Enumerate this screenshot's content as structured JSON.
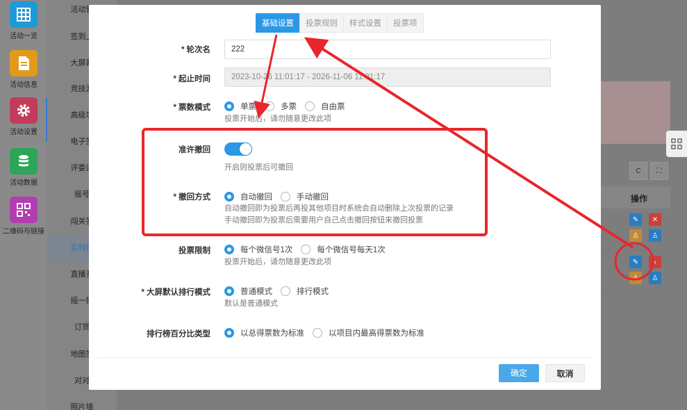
{
  "rail": {
    "items": [
      {
        "label": "活动一览",
        "icon": "grid-icon",
        "color": "#1e9ad6"
      },
      {
        "label": "活动信息",
        "icon": "document-icon",
        "color": "#e39a1b"
      },
      {
        "label": "活动设置",
        "icon": "gear-icon",
        "color": "#c23b5a"
      },
      {
        "label": "活动数据",
        "icon": "database-icon",
        "color": "#2ca556"
      },
      {
        "label": "二维码与链接",
        "icon": "qrcode-icon",
        "color": "#b23db0"
      }
    ]
  },
  "submenu": {
    "items": [
      "活动管",
      "签到上",
      "大屏幕",
      "竞技游",
      "高级功",
      "电子签",
      "评委评",
      "摇号",
      "闯关答",
      "实时投",
      "直播互",
      "摇一摇",
      "订货",
      "地图签",
      "对对",
      "照片墙"
    ]
  },
  "background": {
    "table_op_header": "操作"
  },
  "modal": {
    "tabs": [
      "基础设置",
      "投票规则",
      "样式设置",
      "投票项"
    ],
    "round_name": {
      "label": "轮次名",
      "value": "222"
    },
    "time_range": {
      "label": "起止时间",
      "value": "2023-10-26 11:01:17 - 2026-11-06 11:01:17"
    },
    "vote_mode": {
      "label": "票数模式",
      "options": [
        "单票",
        "多票",
        "自由票"
      ],
      "hint": "投票开始后，请勿随意更改此项"
    },
    "allow_revoke": {
      "label": "准许撤回",
      "hint": "开启则投票后可撤回"
    },
    "revoke_method": {
      "label": "撤回方式",
      "options": [
        "自动撤回",
        "手动撤回"
      ],
      "hint1": "自动撤回即为投票后再投其他项目时系统会自动删除上次投票的记录",
      "hint2": "手动撤回即为投票后需要用户自己点击撤回按钮来撤回投票"
    },
    "vote_limit": {
      "label": "投票限制",
      "options": [
        "每个微信号1次",
        "每个微信号每天1次"
      ],
      "hint": "投票开始后，请勿随意更改此项"
    },
    "rank_mode": {
      "label": "大屏默认排行模式",
      "options": [
        "普通模式",
        "排行模式"
      ],
      "hint": "默认是普通模式"
    },
    "percent_type": {
      "label": "排行榜百分比类型",
      "options": [
        "以总得票数为标准",
        "以项目内最高得票数为标准"
      ]
    },
    "ok": "确定",
    "cancel": "取消"
  },
  "colors": {
    "accent": "#2b98e6",
    "annotation": "#e8262b"
  }
}
